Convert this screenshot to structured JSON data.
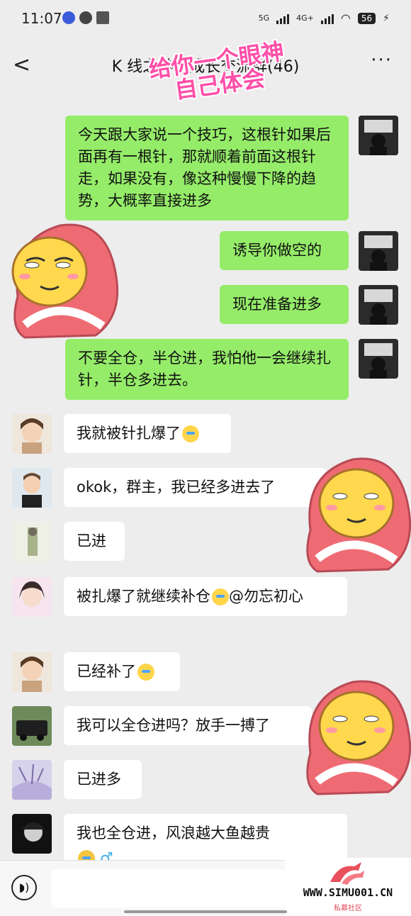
{
  "status": {
    "time": "11:07",
    "net1": "5G",
    "net2": "4G+",
    "battery": "56"
  },
  "header": {
    "back": "<",
    "title": "K 线之神的成长交流群(46)",
    "more": "···"
  },
  "sticker_text": "给你一个眼神 自己体会",
  "messages": [
    {
      "who": "me",
      "text": "今天跟大家说一个技巧，这根针如果后面再有一根针，那就顺着前面这根针走，如果没有，像这种慢慢下降的趋势，大概率直接进多"
    },
    {
      "who": "me",
      "text": "诱导你做空的"
    },
    {
      "who": "me",
      "text": "现在准备进多"
    },
    {
      "who": "me",
      "text": "不要全仓，半仓进，我怕他一会继续扎针，半仓多进去。"
    },
    {
      "who": "other",
      "text": "我就被针扎爆了"
    },
    {
      "who": "other",
      "text": "okok，群主，我已经多进去了"
    },
    {
      "who": "other",
      "text": "已进"
    },
    {
      "who": "other",
      "text": " 被扎爆了就继续补仓"
    },
    {
      "who": "other",
      "text": "@勿忘初心"
    },
    {
      "who": "other",
      "text": "已经补了"
    },
    {
      "who": "other",
      "text": "我可以全仓进吗？放手一搏了"
    },
    {
      "who": "other",
      "text": "已进多"
    },
    {
      "who": "other",
      "text": "我也全仓进，风浪越大鱼越贵"
    }
  ],
  "watermark": {
    "site": "WWW.SIMU001.CN",
    "sub": "私募社区"
  },
  "colors": {
    "me_bubble": "#95ec69",
    "other_bubble": "#ffffff",
    "bg": "#ededed"
  }
}
